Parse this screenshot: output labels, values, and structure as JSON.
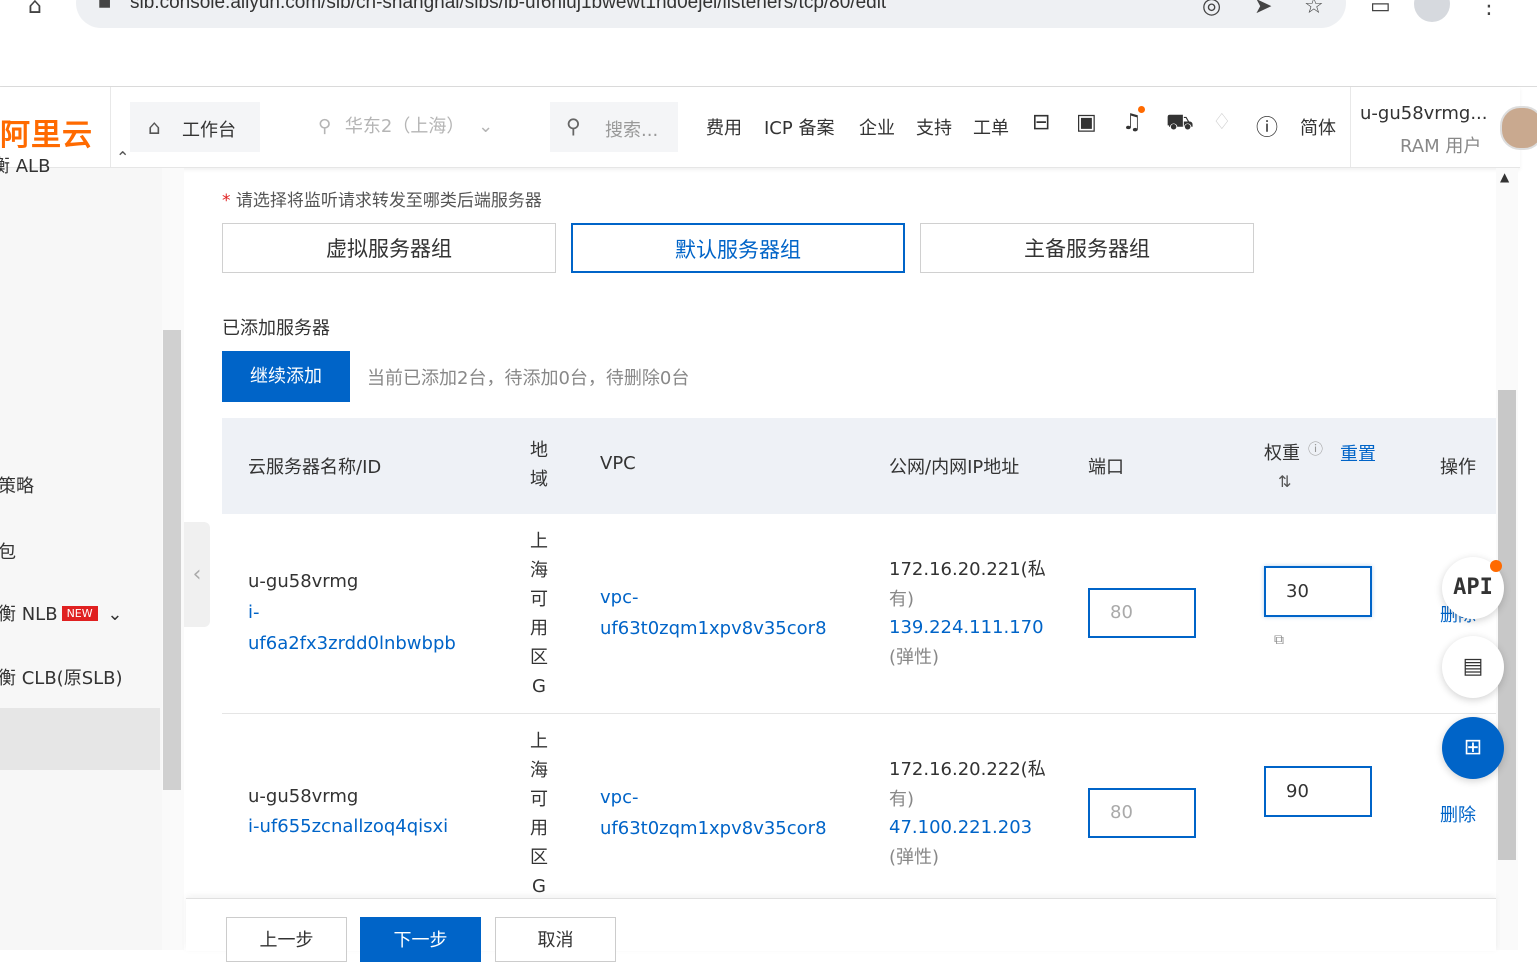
{
  "browser": {
    "url": "slb.console.aliyun.com/slb/cn-shanghai/slbs/lb-uf6niuj1bwewt1nd0ejei/listeners/tcp/80/edit",
    "icons": [
      "home-icon",
      "lock-icon",
      "eye-off-icon",
      "send-icon",
      "star-icon",
      "sidebar-icon",
      "profile-icon",
      "menu-dots-icon"
    ]
  },
  "header": {
    "logo": "阿里云",
    "workbench": "工作台",
    "region": "华东2（上海）",
    "search_placeholder": "搜索...",
    "links": [
      "费用",
      "ICP 备案",
      "企业",
      "支持",
      "工单"
    ],
    "language": "简体",
    "user_name": "u-gu58vrmg...",
    "user_role": "RAM 用户"
  },
  "sidebar": {
    "items": [
      {
        "label": "衡 ALB"
      },
      {
        "label": "策略"
      },
      {
        "label": "包"
      },
      {
        "label": "衡 NLB",
        "badge": "NEW"
      },
      {
        "label": "衡 CLB(原SLB)"
      }
    ]
  },
  "form": {
    "required_label": "请选择将监听请求转发至哪类后端服务器",
    "tabs": [
      "虚拟服务器组",
      "默认服务器组",
      "主备服务器组"
    ],
    "active_tab": 1,
    "added_title": "已添加服务器",
    "add_button": "继续添加",
    "add_status": "当前已添加2台，待添加0台，待删除0台"
  },
  "table": {
    "headers": {
      "name": "云服务器名称/ID",
      "region": "地域",
      "vpc": "VPC",
      "ip": "公网/内网IP地址",
      "port": "端口",
      "weight": "权重",
      "reset": "重置",
      "action": "操作"
    },
    "rows": [
      {
        "name": "u-gu58vrmg",
        "id_line1": "i-",
        "id_line2": "uf6a2fx3zrdd0lnbwbpb",
        "region": "上海可用区G",
        "vpc_line1": "vpc-",
        "vpc_line2": "uf63t0zqm1xpv8v35cor8",
        "private_ip": "172.16.20.221(私",
        "private_ip_tail": "有)",
        "public_ip": "139.224.111.170",
        "public_tag": "(弹性)",
        "port": "80",
        "weight": "30",
        "action": "删除"
      },
      {
        "name": "u-gu58vrmg",
        "id_line1": "i-uf655zcnallzoq4qisxi",
        "id_line2": "",
        "region": "上海可用区G",
        "vpc_line1": "vpc-",
        "vpc_line2": "uf63t0zqm1xpv8v35cor8",
        "private_ip": "172.16.20.222(私",
        "private_ip_tail": "有)",
        "public_ip": "47.100.221.203",
        "public_tag": "(弹性)",
        "port": "80",
        "weight": "90",
        "action": "删除"
      }
    ]
  },
  "widgets": {
    "api_label": "API"
  },
  "footer": {
    "prev": "上一步",
    "next": "下一步",
    "cancel": "取消"
  },
  "colors": {
    "primary": "#0064c8",
    "brand": "#ff6a00",
    "required": "#e02020"
  }
}
